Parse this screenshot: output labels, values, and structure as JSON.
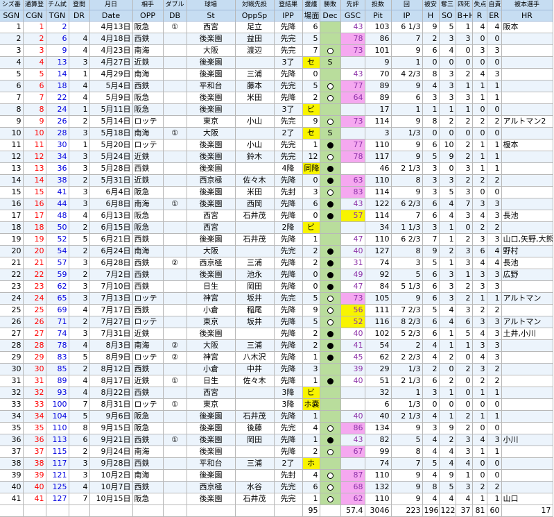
{
  "header_jp": [
    "シズ番",
    "通算登",
    "チム試",
    "登間",
    "月日",
    "相手",
    "ダブル",
    "球場",
    "対戦先投",
    "登結果",
    "援護",
    "勝敗",
    "先評",
    "投数",
    "回",
    "被安",
    "奪三",
    "四死",
    "失点",
    "自責",
    "被本選手"
  ],
  "header_en": [
    "SGN",
    "CGN",
    "TGN",
    "DR",
    "Date",
    "OPP",
    "DB",
    "St",
    "OppSp",
    "IPP",
    "場面",
    "Dec",
    "GSC",
    "Pit",
    "IP",
    "H",
    "SO",
    "B+H",
    "R",
    "ER",
    "HR"
  ],
  "rows": [
    {
      "sgn": "1",
      "cgn": "1",
      "tgn": "2",
      "dr": "",
      "date": "4月13日",
      "opp": "阪急",
      "db": "①",
      "st": "西宮",
      "oppsp": "足立",
      "ipp": "先降",
      "sup": "6",
      "dec": "",
      "gsc": "43",
      "pit": "103",
      "ip": "6 1/3",
      "h": "9",
      "so": "5",
      "bb": "1",
      "r": "4",
      "er": "4",
      "hr": "阪本"
    },
    {
      "sgn": "2",
      "cgn": "2",
      "tgn": "6",
      "dr": "4",
      "date": "4月18日",
      "opp": "西鉄",
      "db": "",
      "st": "後楽園",
      "oppsp": "益田",
      "ipp": "先完",
      "sup": "5",
      "dec": "",
      "gsc": "78",
      "pit": "86",
      "ip": "7",
      "h": "2",
      "so": "3",
      "bb": "3",
      "r": "0",
      "er": "0",
      "hr": ""
    },
    {
      "sgn": "3",
      "cgn": "3",
      "tgn": "9",
      "dr": "4",
      "date": "4月23日",
      "opp": "南海",
      "db": "",
      "st": "大阪",
      "oppsp": "渡辺",
      "ipp": "先完",
      "sup": "7",
      "dec": "W",
      "gsc": "73",
      "pit": "101",
      "ip": "9",
      "h": "6",
      "so": "4",
      "bb": "0",
      "r": "3",
      "er": "3",
      "hr": ""
    },
    {
      "sgn": "4",
      "cgn": "4",
      "tgn": "13",
      "dr": "3",
      "date": "4月27日",
      "opp": "近鉄",
      "db": "",
      "st": "後楽園",
      "oppsp": "",
      "ipp": "3了",
      "sup": "セ",
      "dec": "S",
      "gsc": "",
      "pit": "9",
      "ip": "1",
      "h": "0",
      "so": "0",
      "bb": "0",
      "r": "0",
      "er": "0",
      "hr": ""
    },
    {
      "sgn": "5",
      "cgn": "5",
      "tgn": "14",
      "dr": "1",
      "date": "4月29日",
      "opp": "南海",
      "db": "",
      "st": "後楽園",
      "oppsp": "三浦",
      "ipp": "先降",
      "sup": "0",
      "dec": "",
      "gsc": "43",
      "pit": "70",
      "ip": "4 2/3",
      "h": "8",
      "so": "3",
      "bb": "2",
      "r": "4",
      "er": "3",
      "hr": ""
    },
    {
      "sgn": "6",
      "cgn": "6",
      "tgn": "18",
      "dr": "4",
      "date": "5月4日",
      "opp": "西鉄",
      "db": "",
      "st": "平和台",
      "oppsp": "藤本",
      "ipp": "先完",
      "sup": "5",
      "dec": "W",
      "gsc": "77",
      "pit": "89",
      "ip": "9",
      "h": "4",
      "so": "3",
      "bb": "1",
      "r": "1",
      "er": "1",
      "hr": ""
    },
    {
      "sgn": "7",
      "cgn": "7",
      "tgn": "22",
      "dr": "4",
      "date": "5月9日",
      "opp": "阪急",
      "db": "",
      "st": "後楽園",
      "oppsp": "米田",
      "ipp": "先降",
      "sup": "2",
      "dec": "W",
      "gsc": "64",
      "pit": "89",
      "ip": "6",
      "h": "3",
      "so": "3",
      "bb": "3",
      "r": "1",
      "er": "1",
      "hr": ""
    },
    {
      "sgn": "8",
      "cgn": "8",
      "tgn": "24",
      "dr": "1",
      "date": "5月11日",
      "opp": "阪急",
      "db": "",
      "st": "後楽園",
      "oppsp": "",
      "ipp": "3了",
      "sup": "ビ",
      "dec": "",
      "gsc": "",
      "pit": "17",
      "ip": "1",
      "h": "1",
      "so": "1",
      "bb": "1",
      "r": "0",
      "er": "0",
      "hr": ""
    },
    {
      "sgn": "9",
      "cgn": "9",
      "tgn": "26",
      "dr": "2",
      "date": "5月14日",
      "opp": "ロッテ",
      "db": "",
      "st": "東京",
      "oppsp": "小山",
      "ipp": "先完",
      "sup": "9",
      "dec": "W",
      "gsc": "73",
      "pit": "114",
      "ip": "9",
      "h": "8",
      "so": "2",
      "bb": "2",
      "r": "2",
      "er": "2",
      "hr": "アルトマン2"
    },
    {
      "sgn": "10",
      "cgn": "10",
      "tgn": "28",
      "dr": "3",
      "date": "5月18日",
      "opp": "南海",
      "db": "①",
      "st": "大阪",
      "oppsp": "",
      "ipp": "2了",
      "sup": "セ",
      "dec": "S",
      "gsc": "",
      "pit": "3",
      "ip": "1/3",
      "h": "0",
      "so": "0",
      "bb": "0",
      "r": "0",
      "er": "0",
      "hr": ""
    },
    {
      "sgn": "11",
      "cgn": "11",
      "tgn": "30",
      "dr": "1",
      "date": "5月20日",
      "opp": "ロッテ",
      "db": "",
      "st": "後楽園",
      "oppsp": "小山",
      "ipp": "先完",
      "sup": "1",
      "dec": "L",
      "gsc": "77",
      "pit": "110",
      "ip": "9",
      "h": "6",
      "so": "10",
      "bb": "2",
      "r": "1",
      "er": "1",
      "hr": "榎本"
    },
    {
      "sgn": "12",
      "cgn": "12",
      "tgn": "34",
      "dr": "3",
      "date": "5月24日",
      "opp": "近鉄",
      "db": "",
      "st": "後楽園",
      "oppsp": "鈴木",
      "ipp": "先完",
      "sup": "12",
      "dec": "W",
      "gsc": "78",
      "pit": "117",
      "ip": "9",
      "h": "5",
      "so": "9",
      "bb": "2",
      "r": "1",
      "er": "1",
      "hr": ""
    },
    {
      "sgn": "13",
      "cgn": "13",
      "tgn": "36",
      "dr": "3",
      "date": "5月28日",
      "opp": "西鉄",
      "db": "",
      "st": "後楽園",
      "oppsp": "",
      "ipp": "4降",
      "sup": "同降",
      "dec": "L",
      "gsc": "",
      "pit": "46",
      "ip": "2 1/3",
      "h": "3",
      "so": "0",
      "bb": "3",
      "r": "1",
      "er": "1",
      "hr": ""
    },
    {
      "sgn": "14",
      "cgn": "14",
      "tgn": "38",
      "dr": "2",
      "date": "5月31日",
      "opp": "近鉄",
      "db": "",
      "st": "西京極",
      "oppsp": "佐々木",
      "ipp": "先降",
      "sup": "0",
      "dec": "L",
      "gsc": "63",
      "pit": "110",
      "ip": "8",
      "h": "3",
      "so": "3",
      "bb": "2",
      "r": "2",
      "er": "2",
      "hr": ""
    },
    {
      "sgn": "15",
      "cgn": "15",
      "tgn": "41",
      "dr": "3",
      "date": "6月4日",
      "opp": "阪急",
      "db": "",
      "st": "後楽園",
      "oppsp": "米田",
      "ipp": "先封",
      "sup": "3",
      "dec": "W",
      "gsc": "83",
      "pit": "114",
      "ip": "9",
      "h": "3",
      "so": "5",
      "bb": "3",
      "r": "0",
      "er": "0",
      "hr": ""
    },
    {
      "sgn": "16",
      "cgn": "16",
      "tgn": "44",
      "dr": "3",
      "date": "6月8日",
      "opp": "南海",
      "db": "①",
      "st": "後楽園",
      "oppsp": "西岡",
      "ipp": "先降",
      "sup": "6",
      "dec": "L",
      "gsc": "43",
      "pit": "122",
      "ip": "6 2/3",
      "h": "6",
      "so": "4",
      "bb": "7",
      "r": "3",
      "er": "3",
      "hr": ""
    },
    {
      "sgn": "17",
      "cgn": "17",
      "tgn": "48",
      "dr": "4",
      "date": "6月13日",
      "opp": "阪急",
      "db": "",
      "st": "西宮",
      "oppsp": "石井茂",
      "ipp": "先降",
      "sup": "0",
      "dec": "L",
      "gsc": "57",
      "pit": "114",
      "ip": "7",
      "h": "6",
      "so": "4",
      "bb": "3",
      "r": "4",
      "er": "3",
      "hr": "長池"
    },
    {
      "sgn": "18",
      "cgn": "18",
      "tgn": "50",
      "dr": "2",
      "date": "6月15日",
      "opp": "阪急",
      "db": "",
      "st": "西宮",
      "oppsp": "",
      "ipp": "2降",
      "sup": "ビ",
      "dec": "",
      "gsc": "",
      "pit": "34",
      "ip": "1 1/3",
      "h": "3",
      "so": "1",
      "bb": "0",
      "r": "2",
      "er": "2",
      "hr": ""
    },
    {
      "sgn": "19",
      "cgn": "19",
      "tgn": "52",
      "dr": "5",
      "date": "6月21日",
      "opp": "西鉄",
      "db": "",
      "st": "後楽園",
      "oppsp": "石井茂",
      "ipp": "先降",
      "sup": "1",
      "dec": "",
      "gsc": "47",
      "pit": "110",
      "ip": "6 2/3",
      "h": "7",
      "so": "1",
      "bb": "2",
      "r": "3",
      "er": "3",
      "hr": "山口,矢野,大熊"
    },
    {
      "sgn": "20",
      "cgn": "20",
      "tgn": "54",
      "dr": "2",
      "date": "6月24日",
      "opp": "南海",
      "db": "",
      "st": "大阪",
      "oppsp": "",
      "ipp": "先完",
      "sup": "2",
      "dec": "L",
      "gsc": "40",
      "pit": "127",
      "ip": "8",
      "h": "9",
      "so": "2",
      "bb": "3",
      "r": "6",
      "er": "4",
      "hr": "野村"
    },
    {
      "sgn": "21",
      "cgn": "21",
      "tgn": "57",
      "dr": "3",
      "date": "6月28日",
      "opp": "西鉄",
      "db": "②",
      "st": "西京極",
      "oppsp": "三浦",
      "ipp": "先降",
      "sup": "2",
      "dec": "L",
      "gsc": "31",
      "pit": "74",
      "ip": "3",
      "h": "5",
      "so": "1",
      "bb": "3",
      "r": "4",
      "er": "4",
      "hr": "長池"
    },
    {
      "sgn": "22",
      "cgn": "22",
      "tgn": "59",
      "dr": "2",
      "date": "7月2日",
      "opp": "西鉄",
      "db": "",
      "st": "後楽園",
      "oppsp": "池永",
      "ipp": "先降",
      "sup": "0",
      "dec": "L",
      "gsc": "49",
      "pit": "92",
      "ip": "5",
      "h": "6",
      "so": "3",
      "bb": "1",
      "r": "3",
      "er": "3",
      "hr": "広野"
    },
    {
      "sgn": "23",
      "cgn": "23",
      "tgn": "62",
      "dr": "3",
      "date": "7月10日",
      "opp": "西鉄",
      "db": "",
      "st": "日生",
      "oppsp": "岡田",
      "ipp": "先降",
      "sup": "0",
      "dec": "L",
      "gsc": "47",
      "pit": "84",
      "ip": "5 1/3",
      "h": "6",
      "so": "3",
      "bb": "2",
      "r": "3",
      "er": "3",
      "hr": ""
    },
    {
      "sgn": "24",
      "cgn": "24",
      "tgn": "65",
      "dr": "3",
      "date": "7月13日",
      "opp": "ロッテ",
      "db": "",
      "st": "神宮",
      "oppsp": "坂井",
      "ipp": "先完",
      "sup": "5",
      "dec": "W",
      "gsc": "73",
      "pit": "105",
      "ip": "9",
      "h": "6",
      "so": "3",
      "bb": "2",
      "r": "1",
      "er": "1",
      "hr": "アルトマン"
    },
    {
      "sgn": "25",
      "cgn": "25",
      "tgn": "69",
      "dr": "4",
      "date": "7月17日",
      "opp": "西鉄",
      "db": "",
      "st": "小倉",
      "oppsp": "稲尾",
      "ipp": "先降",
      "sup": "9",
      "dec": "W",
      "gsc": "56",
      "pit": "111",
      "ip": "7 2/3",
      "h": "5",
      "so": "4",
      "bb": "3",
      "r": "2",
      "er": "2",
      "hr": ""
    },
    {
      "sgn": "26",
      "cgn": "26",
      "tgn": "71",
      "dr": "2",
      "date": "7月27日",
      "opp": "ロッテ",
      "db": "",
      "st": "東京",
      "oppsp": "坂井",
      "ipp": "先降",
      "sup": "5",
      "dec": "W",
      "gsc": "52",
      "pit": "116",
      "ip": "8 2/3",
      "h": "6",
      "so": "4",
      "bb": "6",
      "r": "3",
      "er": "3",
      "hr": "アルトマン"
    },
    {
      "sgn": "27",
      "cgn": "27",
      "tgn": "74",
      "dr": "3",
      "date": "7月31日",
      "opp": "近鉄",
      "db": "",
      "st": "後楽園",
      "oppsp": "",
      "ipp": "先降",
      "sup": "2",
      "dec": "L",
      "gsc": "40",
      "pit": "102",
      "ip": "5 2/3",
      "h": "6",
      "so": "1",
      "bb": "5",
      "r": "4",
      "er": "3",
      "hr": "土井,小川"
    },
    {
      "sgn": "28",
      "cgn": "28",
      "tgn": "78",
      "dr": "4",
      "date": "8月3日",
      "opp": "南海",
      "db": "②",
      "st": "大阪",
      "oppsp": "三浦",
      "ipp": "先降",
      "sup": "2",
      "dec": "L",
      "gsc": "41",
      "pit": "54",
      "ip": "2",
      "h": "4",
      "so": "1",
      "bb": "1",
      "r": "3",
      "er": "3",
      "hr": ""
    },
    {
      "sgn": "29",
      "cgn": "29",
      "tgn": "83",
      "dr": "5",
      "date": "8月9日",
      "opp": "ロッテ",
      "db": "②",
      "st": "神宮",
      "oppsp": "八木沢",
      "ipp": "先降",
      "sup": "1",
      "dec": "L",
      "gsc": "45",
      "pit": "62",
      "ip": "2 2/3",
      "h": "4",
      "so": "2",
      "bb": "0",
      "r": "4",
      "er": "3",
      "hr": ""
    },
    {
      "sgn": "30",
      "cgn": "30",
      "tgn": "85",
      "dr": "2",
      "date": "8月12日",
      "opp": "西鉄",
      "db": "",
      "st": "小倉",
      "oppsp": "中井",
      "ipp": "先降",
      "sup": "3",
      "dec": "",
      "gsc": "39",
      "pit": "29",
      "ip": "1/3",
      "h": "2",
      "so": "0",
      "bb": "2",
      "r": "3",
      "er": "2",
      "hr": ""
    },
    {
      "sgn": "31",
      "cgn": "31",
      "tgn": "89",
      "dr": "4",
      "date": "8月17日",
      "opp": "近鉄",
      "db": "①",
      "st": "日生",
      "oppsp": "佐々木",
      "ipp": "先降",
      "sup": "1",
      "dec": "L",
      "gsc": "40",
      "pit": "51",
      "ip": "2 1/3",
      "h": "6",
      "so": "2",
      "bb": "0",
      "r": "2",
      "er": "2",
      "hr": ""
    },
    {
      "sgn": "32",
      "cgn": "32",
      "tgn": "93",
      "dr": "4",
      "date": "8月22日",
      "opp": "西鉄",
      "db": "",
      "st": "西宮",
      "oppsp": "",
      "ipp": "3降",
      "sup": "ビ",
      "dec": "",
      "gsc": "",
      "pit": "32",
      "ip": "1",
      "h": "3",
      "so": "1",
      "bb": "0",
      "r": "1",
      "er": "1",
      "hr": ""
    },
    {
      "sgn": "33",
      "cgn": "33",
      "tgn": "100",
      "dr": "7",
      "date": "8月31日",
      "opp": "ロッテ",
      "db": "①",
      "st": "東京",
      "oppsp": "",
      "ipp": "3降",
      "sup": "ホ嚢",
      "dec": "",
      "gsc": "",
      "pit": "6",
      "ip": "1/3",
      "h": "0",
      "so": "0",
      "bb": "0",
      "r": "0",
      "er": "0",
      "hr": ""
    },
    {
      "sgn": "34",
      "cgn": "34",
      "tgn": "104",
      "dr": "5",
      "date": "9月6日",
      "opp": "阪急",
      "db": "",
      "st": "後楽園",
      "oppsp": "石井茂",
      "ipp": "先降",
      "sup": "1",
      "dec": "",
      "gsc": "40",
      "pit": "40",
      "ip": "2 1/3",
      "h": "4",
      "so": "1",
      "bb": "2",
      "r": "1",
      "er": "1",
      "hr": ""
    },
    {
      "sgn": "35",
      "cgn": "35",
      "tgn": "110",
      "dr": "8",
      "date": "9月15日",
      "opp": "阪急",
      "db": "",
      "st": "後楽園",
      "oppsp": "後藤",
      "ipp": "先完",
      "sup": "4",
      "dec": "W",
      "gsc": "86",
      "pit": "134",
      "ip": "9",
      "h": "3",
      "so": "9",
      "bb": "2",
      "r": "0",
      "er": "0",
      "hr": ""
    },
    {
      "sgn": "36",
      "cgn": "36",
      "tgn": "113",
      "dr": "6",
      "date": "9月21日",
      "opp": "西鉄",
      "db": "①",
      "st": "後楽園",
      "oppsp": "岡田",
      "ipp": "先降",
      "sup": "1",
      "dec": "L",
      "gsc": "43",
      "pit": "82",
      "ip": "5",
      "h": "4",
      "so": "2",
      "bb": "3",
      "r": "4",
      "er": "3",
      "hr": "小川"
    },
    {
      "sgn": "37",
      "cgn": "37",
      "tgn": "115",
      "dr": "2",
      "date": "9月24日",
      "opp": "南海",
      "db": "",
      "st": "後楽園",
      "oppsp": "",
      "ipp": "先降",
      "sup": "2",
      "dec": "W",
      "gsc": "67",
      "pit": "99",
      "ip": "8",
      "h": "4",
      "so": "4",
      "bb": "3",
      "r": "1",
      "er": "1",
      "hr": ""
    },
    {
      "sgn": "38",
      "cgn": "38",
      "tgn": "117",
      "dr": "3",
      "date": "9月28日",
      "opp": "西鉄",
      "db": "",
      "st": "平和台",
      "oppsp": "三浦",
      "ipp": "2了",
      "sup": "ホ",
      "dec": "",
      "gsc": "",
      "pit": "74",
      "ip": "7",
      "h": "5",
      "so": "4",
      "bb": "4",
      "r": "0",
      "er": "0",
      "hr": ""
    },
    {
      "sgn": "39",
      "cgn": "39",
      "tgn": "121",
      "dr": "3",
      "date": "10月2日",
      "opp": "南海",
      "db": "",
      "st": "後楽園",
      "oppsp": "",
      "ipp": "先封",
      "sup": "4",
      "dec": "W",
      "gsc": "87",
      "pit": "110",
      "ip": "9",
      "h": "4",
      "so": "9",
      "bb": "1",
      "r": "0",
      "er": "0",
      "hr": ""
    },
    {
      "sgn": "40",
      "cgn": "40",
      "tgn": "125",
      "dr": "4",
      "date": "10月7日",
      "opp": "西鉄",
      "db": "",
      "st": "西京極",
      "oppsp": "水谷",
      "ipp": "先完",
      "sup": "6",
      "dec": "W",
      "gsc": "68",
      "pit": "132",
      "ip": "9",
      "h": "8",
      "so": "5",
      "bb": "3",
      "r": "2",
      "er": "2",
      "hr": ""
    },
    {
      "sgn": "41",
      "cgn": "41",
      "tgn": "127",
      "dr": "7",
      "date": "10月15日",
      "opp": "阪急",
      "db": "",
      "st": "後楽園",
      "oppsp": "石井茂",
      "ipp": "先完",
      "sup": "1",
      "dec": "W",
      "gsc": "62",
      "pit": "110",
      "ip": "9",
      "h": "4",
      "so": "4",
      "bb": "4",
      "r": "1",
      "er": "1",
      "hr": "山口"
    }
  ],
  "totals": {
    "sup": "95",
    "gsc": "57.4",
    "pit": "3046",
    "ip": "223",
    "h": "196",
    "so": "122",
    "bb": "37",
    "r": "81",
    "er": "60",
    "hr": "17"
  },
  "colors": {
    "gsc_high": "#f5a8f0",
    "gsc_mid": "#f8f400",
    "dec_bg": "#b9dd9c",
    "header": "#c6ddf2",
    "cgn_color": "#ff0000",
    "tgn_color": "#0000e0",
    "gsc_color": "#8d32a8"
  }
}
